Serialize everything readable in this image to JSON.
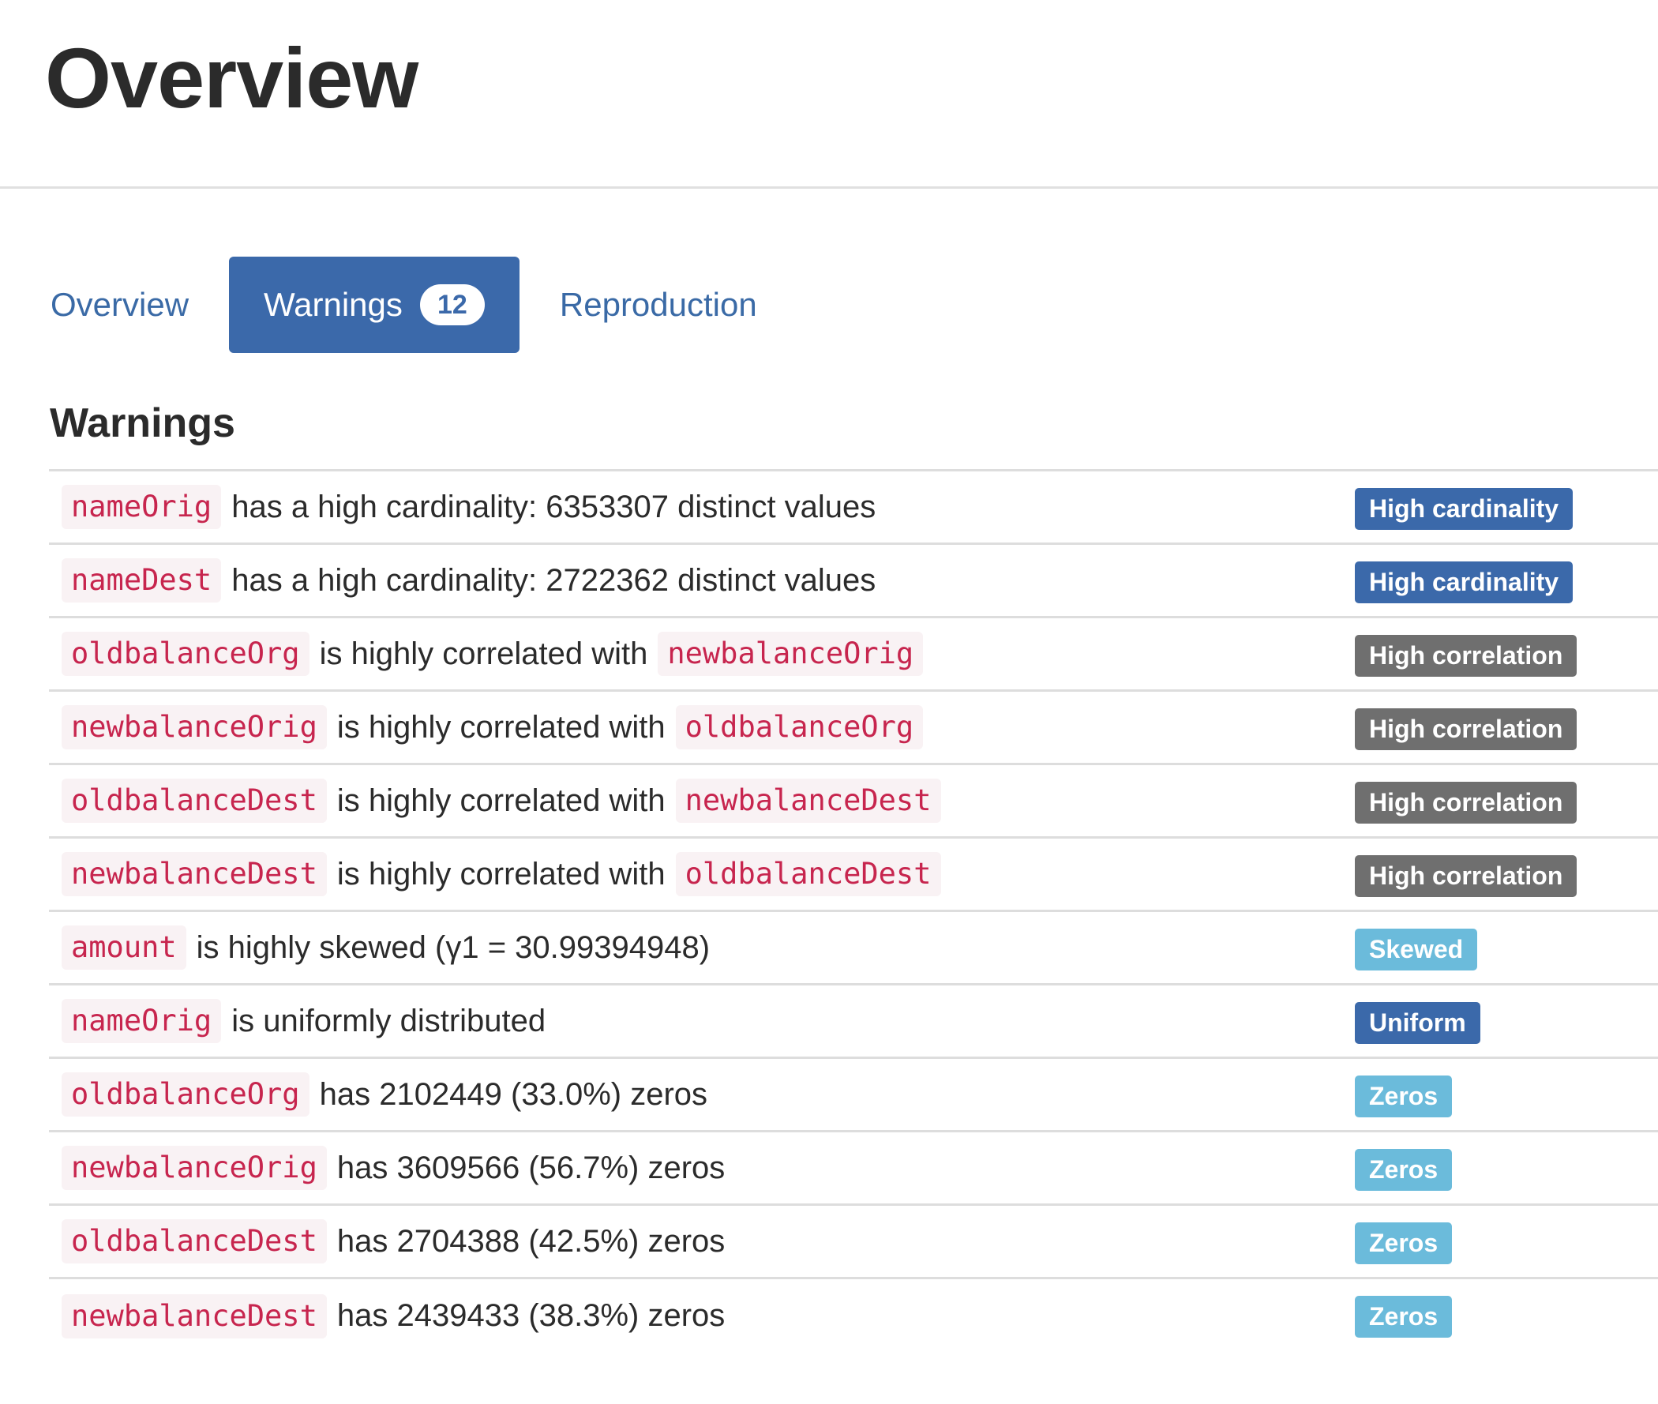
{
  "header": {
    "title": "Overview"
  },
  "tabs": [
    {
      "label": "Overview"
    },
    {
      "label": "Warnings",
      "badge": "12"
    },
    {
      "label": "Reproduction"
    }
  ],
  "section_title": "Warnings",
  "colors": {
    "accent": "#3b69aa",
    "code_text": "#c7254e",
    "code_bg": "#f9f2f4",
    "badge_correlation": "#6f6f6f",
    "badge_info": "#6bbbdb"
  },
  "warnings": [
    {
      "var1": "nameOrig",
      "text": "has a high cardinality: 6353307 distinct values",
      "var2": "",
      "badge": "High cardinality"
    },
    {
      "var1": "nameDest",
      "text": "has a high cardinality: 2722362 distinct values",
      "var2": "",
      "badge": "High cardinality"
    },
    {
      "var1": "oldbalanceOrg",
      "text": "is highly correlated with",
      "var2": "newbalanceOrig",
      "badge": "High correlation"
    },
    {
      "var1": "newbalanceOrig",
      "text": "is highly correlated with",
      "var2": "oldbalanceOrg",
      "badge": "High correlation"
    },
    {
      "var1": "oldbalanceDest",
      "text": "is highly correlated with",
      "var2": "newbalanceDest",
      "badge": "High correlation"
    },
    {
      "var1": "newbalanceDest",
      "text": "is highly correlated with",
      "var2": "oldbalanceDest",
      "badge": "High correlation"
    },
    {
      "var1": "amount",
      "text": "is highly skewed (γ1 = 30.99394948)",
      "var2": "",
      "badge": "Skewed"
    },
    {
      "var1": "nameOrig",
      "text": "is uniformly distributed",
      "var2": "",
      "badge": "Uniform"
    },
    {
      "var1": "oldbalanceOrg",
      "text": "has 2102449 (33.0%) zeros",
      "var2": "",
      "badge": "Zeros"
    },
    {
      "var1": "newbalanceOrig",
      "text": "has 3609566 (56.7%) zeros",
      "var2": "",
      "badge": "Zeros"
    },
    {
      "var1": "oldbalanceDest",
      "text": "has 2704388 (42.5%) zeros",
      "var2": "",
      "badge": "Zeros"
    },
    {
      "var1": "newbalanceDest",
      "text": "has 2439433 (38.3%) zeros",
      "var2": "",
      "badge": "Zeros"
    }
  ]
}
